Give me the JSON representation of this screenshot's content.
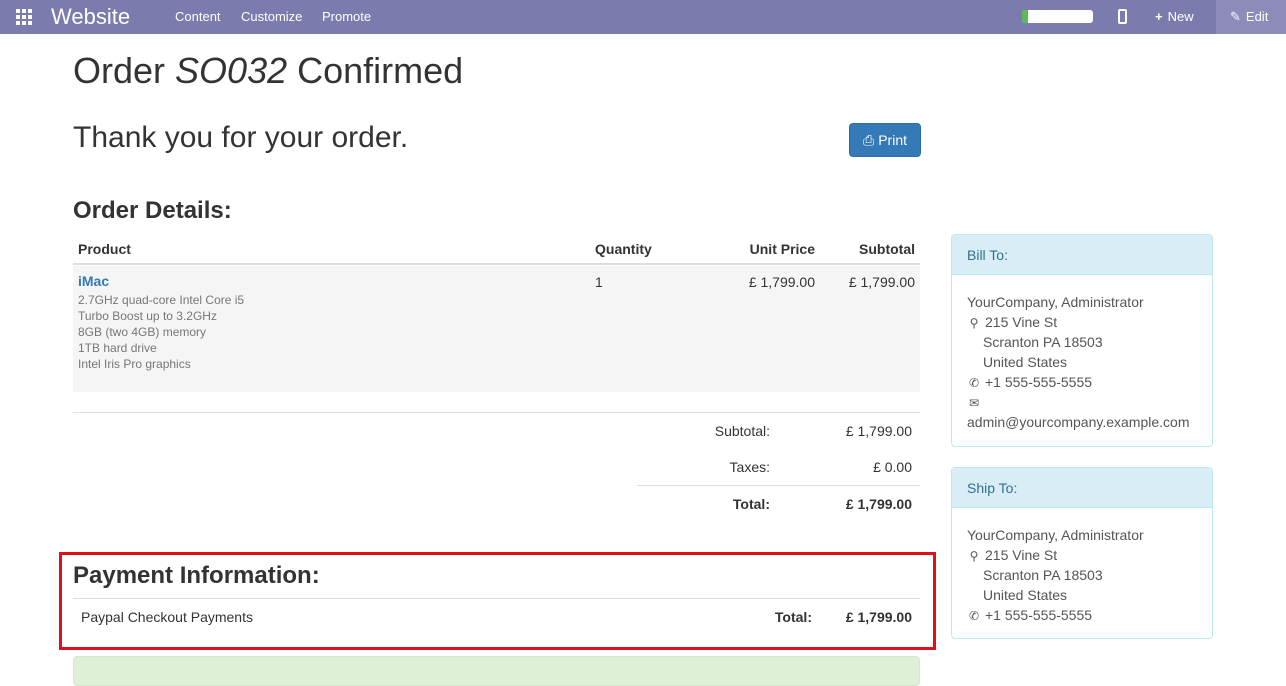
{
  "topbar": {
    "brand": "Website",
    "menu": [
      "Content",
      "Customize",
      "Promote"
    ],
    "progress_fraction": 0.08,
    "new_label": "New",
    "edit_label": "Edit",
    "color": "#7c7bad"
  },
  "order": {
    "title_prefix": "Order ",
    "number": "SO032",
    "title_suffix": " Confirmed",
    "thank_you": "Thank you for your order.",
    "print_label": "Print"
  },
  "details": {
    "heading": "Order Details:",
    "columns": [
      "Product",
      "Quantity",
      "Unit Price",
      "Subtotal"
    ],
    "line": {
      "product": "iMac",
      "description": [
        "2.7GHz quad-core Intel Core i5",
        "Turbo Boost up to 3.2GHz",
        "8GB (two 4GB) memory",
        "1TB hard drive",
        "Intel Iris Pro graphics"
      ],
      "quantity": "1",
      "unit_price": "£ 1,799.00",
      "subtotal": "£ 1,799.00"
    },
    "totals": {
      "subtotal_label": "Subtotal:",
      "subtotal_value": "£ 1,799.00",
      "taxes_label": "Taxes:",
      "taxes_value": "£ 0.00",
      "total_label": "Total:",
      "total_value": "£ 1,799.00"
    }
  },
  "bill_to": {
    "heading": "Bill To:",
    "name": "YourCompany, Administrator",
    "street": "215 Vine St",
    "city": "Scranton PA 18503",
    "country": "United States",
    "phone": "+1 555-555-5555",
    "email": "admin@yourcompany.example.com"
  },
  "ship_to": {
    "heading": "Ship To:",
    "name": "YourCompany, Administrator",
    "street": "215 Vine St",
    "city": "Scranton PA 18503",
    "country": "United States",
    "phone": "+1 555-555-5555"
  },
  "payment": {
    "heading": "Payment Information:",
    "method": "Paypal Checkout Payments",
    "total_label": "Total:",
    "total_value": "£ 1,799.00",
    "highlight_color": "#e10f1b"
  }
}
